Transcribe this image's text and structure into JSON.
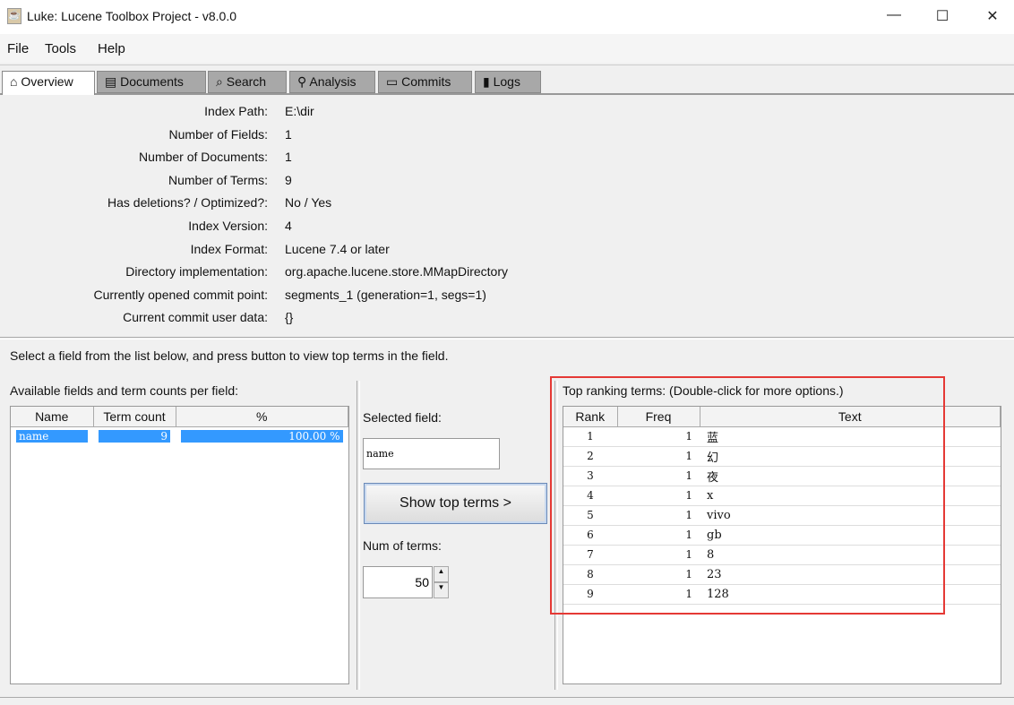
{
  "window": {
    "title": "Luke: Lucene Toolbox Project - v8.0.0",
    "minimize": "—",
    "maximize": "☐",
    "close": "✕"
  },
  "menu": [
    "File",
    "Tools",
    "Help"
  ],
  "tabs": [
    {
      "icon": "⌂",
      "label": "Overview"
    },
    {
      "icon": "▤",
      "label": "Documents"
    },
    {
      "icon": "⌕",
      "label": "Search"
    },
    {
      "icon": "⚲",
      "label": "Analysis"
    },
    {
      "icon": "▭",
      "label": "Commits"
    },
    {
      "icon": "▮",
      "label": "Logs"
    }
  ],
  "overview": [
    {
      "label": "Index Path:",
      "value": "E:\\dir"
    },
    {
      "label": "Number of Fields:",
      "value": "1"
    },
    {
      "label": "Number of Documents:",
      "value": "1"
    },
    {
      "label": "Number of Terms:",
      "value": "9"
    },
    {
      "label": "Has deletions? / Optimized?:",
      "value": "No / Yes"
    },
    {
      "label": "Index Version:",
      "value": "4"
    },
    {
      "label": "Index Format:",
      "value": "Lucene 7.4 or later"
    },
    {
      "label": "Directory implementation:",
      "value": "org.apache.lucene.store.MMapDirectory"
    },
    {
      "label": "Currently opened commit point:",
      "value": "segments_1 (generation=1, segs=1)"
    },
    {
      "label": "Current commit user data:",
      "value": "{}"
    }
  ],
  "instruction": "Select a field from the list below, and press button to view top terms in the field.",
  "fields": {
    "title": "Available fields and term counts per field:",
    "headers": [
      "Name",
      "Term count",
      "%"
    ],
    "rows": [
      {
        "name": "name",
        "count": "9",
        "pct": "100.00 %"
      }
    ]
  },
  "middle": {
    "selected_label": "Selected field:",
    "selected_value": "name",
    "button": "Show top terms >",
    "num_label": "Num of terms:",
    "num_value": "50"
  },
  "terms": {
    "title": "Top ranking terms: (Double-click for more options.)",
    "headers": [
      "Rank",
      "Freq",
      "Text"
    ],
    "rows": [
      [
        "1",
        "1",
        "蓝"
      ],
      [
        "2",
        "1",
        "幻"
      ],
      [
        "3",
        "1",
        "夜"
      ],
      [
        "4",
        "1",
        "x"
      ],
      [
        "5",
        "1",
        "vivo"
      ],
      [
        "6",
        "1",
        "gb"
      ],
      [
        "7",
        "1",
        "8"
      ],
      [
        "8",
        "1",
        "23"
      ],
      [
        "9",
        "1",
        "128"
      ]
    ]
  },
  "colors": {
    "selection": "#3399ff",
    "highlight_box": "#e53935"
  }
}
